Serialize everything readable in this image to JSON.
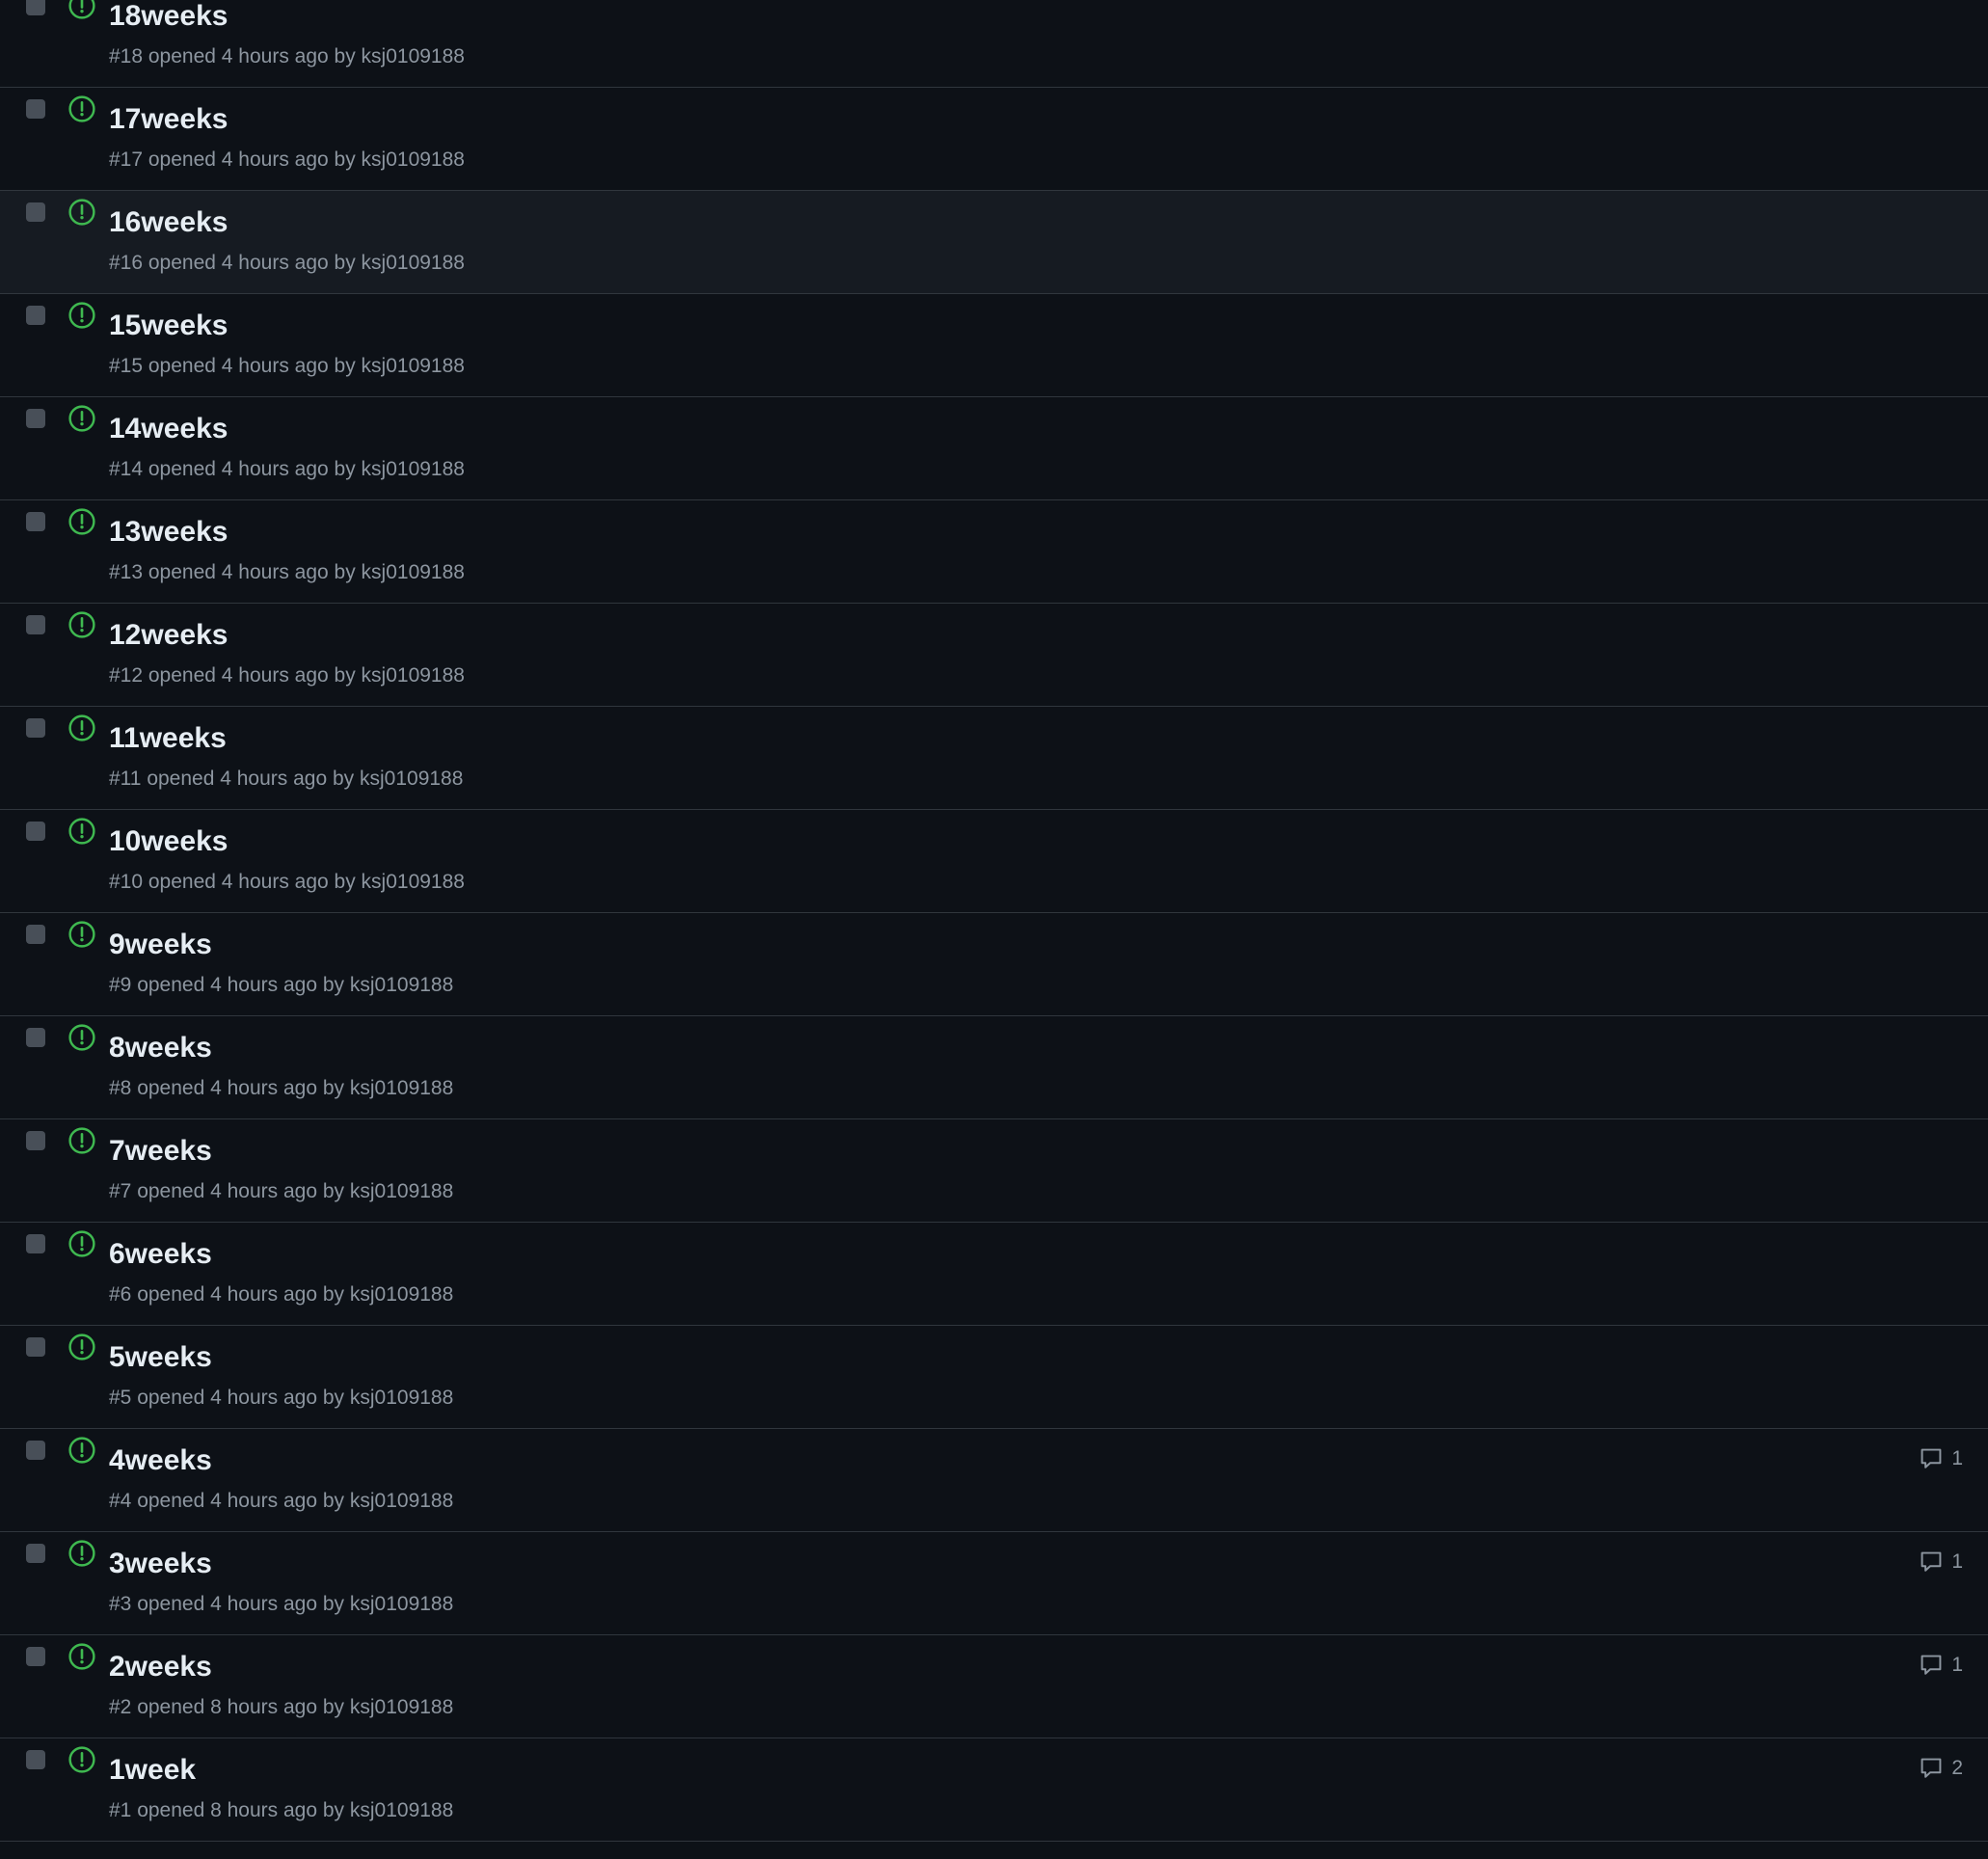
{
  "theme": {
    "background": "#0d1117",
    "hover_background": "#161b22",
    "border": "#30363d",
    "title_color": "#e6edf3",
    "meta_color": "#8d96a0",
    "open_icon_color": "#3fb950",
    "checkbox_color": "#484f58"
  },
  "issues": [
    {
      "title": "18weeks",
      "meta": "#18 opened 4 hours ago by ksj0109188",
      "comments": null,
      "state": "open"
    },
    {
      "title": "17weeks",
      "meta": "#17 opened 4 hours ago by ksj0109188",
      "comments": null,
      "state": "open"
    },
    {
      "title": "16weeks",
      "meta": "#16 opened 4 hours ago by ksj0109188",
      "comments": null,
      "state": "open",
      "hovered": true
    },
    {
      "title": "15weeks",
      "meta": "#15 opened 4 hours ago by ksj0109188",
      "comments": null,
      "state": "open"
    },
    {
      "title": "14weeks",
      "meta": "#14 opened 4 hours ago by ksj0109188",
      "comments": null,
      "state": "open"
    },
    {
      "title": "13weeks",
      "meta": "#13 opened 4 hours ago by ksj0109188",
      "comments": null,
      "state": "open"
    },
    {
      "title": "12weeks",
      "meta": "#12 opened 4 hours ago by ksj0109188",
      "comments": null,
      "state": "open"
    },
    {
      "title": "11weeks",
      "meta": "#11 opened 4 hours ago by ksj0109188",
      "comments": null,
      "state": "open"
    },
    {
      "title": "10weeks",
      "meta": "#10 opened 4 hours ago by ksj0109188",
      "comments": null,
      "state": "open"
    },
    {
      "title": "9weeks",
      "meta": "#9 opened 4 hours ago by ksj0109188",
      "comments": null,
      "state": "open"
    },
    {
      "title": "8weeks",
      "meta": "#8 opened 4 hours ago by ksj0109188",
      "comments": null,
      "state": "open"
    },
    {
      "title": "7weeks",
      "meta": "#7 opened 4 hours ago by ksj0109188",
      "comments": null,
      "state": "open"
    },
    {
      "title": "6weeks",
      "meta": "#6 opened 4 hours ago by ksj0109188",
      "comments": null,
      "state": "open"
    },
    {
      "title": "5weeks",
      "meta": "#5 opened 4 hours ago by ksj0109188",
      "comments": null,
      "state": "open"
    },
    {
      "title": "4weeks",
      "meta": "#4 opened 4 hours ago by ksj0109188",
      "comments": "1",
      "state": "open"
    },
    {
      "title": "3weeks",
      "meta": "#3 opened 4 hours ago by ksj0109188",
      "comments": "1",
      "state": "open"
    },
    {
      "title": "2weeks",
      "meta": "#2 opened 8 hours ago by ksj0109188",
      "comments": "1",
      "state": "open"
    },
    {
      "title": "1week",
      "meta": "#1 opened 8 hours ago by ksj0109188",
      "comments": "2",
      "state": "open"
    }
  ]
}
